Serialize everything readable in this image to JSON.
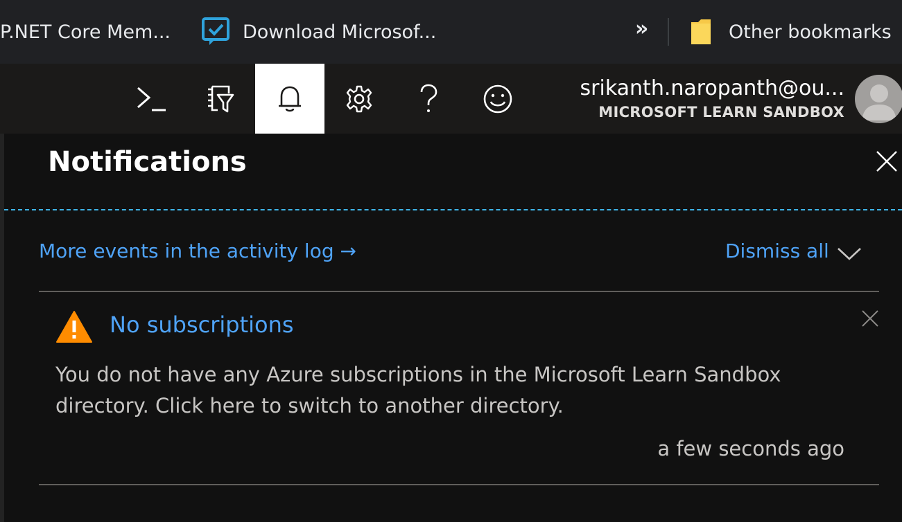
{
  "bookmarks": {
    "items": [
      {
        "label": "P.NET Core Mem..."
      },
      {
        "label": "Download Microsof..."
      }
    ],
    "overflow_label": "»",
    "other_label": "Other bookmarks"
  },
  "topnav": {
    "buttons": [
      {
        "icon": "cloud-shell-icon"
      },
      {
        "icon": "directory-filter-icon"
      },
      {
        "icon": "bell-icon",
        "active": true
      },
      {
        "icon": "gear-icon"
      },
      {
        "icon": "help-icon"
      },
      {
        "icon": "feedback-smiley-icon"
      }
    ],
    "account": {
      "email": "srikanth.naropanth@ou...",
      "directory": "MICROSOFT LEARN SANDBOX"
    }
  },
  "notifications": {
    "title": "Notifications",
    "activity_link": "More events in the activity log →",
    "dismiss_all": "Dismiss all",
    "items": [
      {
        "severity": "warning",
        "title": "No subscriptions",
        "body": "You do not have any Azure subscriptions in the Microsoft Learn Sandbox directory. Click here to switch to another directory.",
        "time": "a few seconds ago"
      }
    ]
  },
  "colors": {
    "link": "#4fa3f7",
    "warning": "#ff8c00",
    "accent_line": "#3fb5e8",
    "background": "#111111"
  }
}
